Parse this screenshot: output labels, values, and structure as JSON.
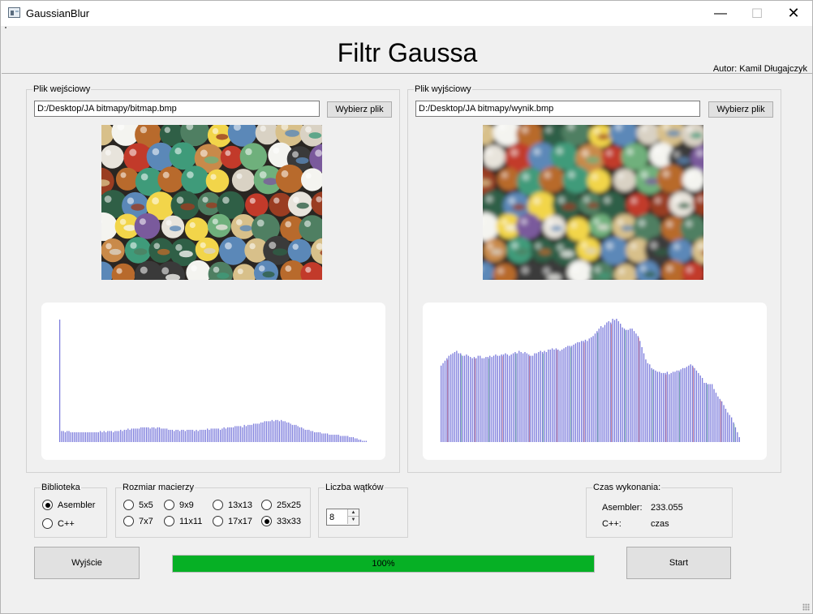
{
  "window": {
    "title": "GaussianBlur",
    "controls": {
      "minimize": "—",
      "maximize": "☐",
      "close": "✕"
    }
  },
  "header": {
    "title": "Filtr Gaussa",
    "author": "Autor: Kamil Długajczyk"
  },
  "input_panel": {
    "label": "Plik wejściowy",
    "path": "D:/Desktop/JA bitmapy/bitmap.bmp",
    "button": "Wybierz plik"
  },
  "output_panel": {
    "label": "Plik wyjściowy",
    "path": "D:/Desktop/JA bitmapy/wynik.bmp",
    "button": "Wybierz plik"
  },
  "library": {
    "label": "Biblioteka",
    "options": [
      {
        "label": "Asembler",
        "checked": true
      },
      {
        "label": "C++",
        "checked": false
      }
    ]
  },
  "matrix": {
    "label": "Rozmiar macierzy",
    "options": [
      {
        "label": "5x5",
        "checked": false
      },
      {
        "label": "9x9",
        "checked": false
      },
      {
        "label": "13x13",
        "checked": false
      },
      {
        "label": "25x25",
        "checked": false
      },
      {
        "label": "7x7",
        "checked": false
      },
      {
        "label": "11x11",
        "checked": false
      },
      {
        "label": "17x17",
        "checked": false
      },
      {
        "label": "33x33",
        "checked": true
      }
    ]
  },
  "threads": {
    "label": "Liczba wątków",
    "value": "8"
  },
  "timing": {
    "label": "Czas wykonania:",
    "asm_label": "Asembler:",
    "asm_value": "233.055",
    "cpp_label": "C++:",
    "cpp_value": "czas"
  },
  "buttons": {
    "exit": "Wyjście",
    "start": "Start"
  },
  "progress": {
    "value": 100,
    "text": "100%"
  },
  "colors": {
    "progress": "#06b025",
    "histogram_bar": "#7b7bdc",
    "histogram_red": "#d96b6b",
    "histogram_green": "#6bc48a"
  },
  "chart_data": [
    {
      "type": "bar",
      "values": [
        100,
        9,
        9,
        8,
        9,
        9,
        8,
        8,
        8,
        8,
        8,
        8,
        8,
        8,
        8,
        8,
        8,
        8,
        8,
        8,
        8,
        8,
        9,
        8,
        9,
        8,
        9,
        9,
        9,
        8,
        9,
        9,
        9,
        10,
        9,
        10,
        10,
        11,
        10,
        11,
        11,
        11,
        11,
        11,
        12,
        12,
        12,
        12,
        12,
        11,
        12,
        12,
        11,
        12,
        12,
        11,
        11,
        11,
        11,
        10,
        10,
        10,
        9,
        10,
        10,
        9,
        10,
        10,
        9,
        10,
        10,
        10,
        10,
        9,
        10,
        9,
        10,
        10,
        10,
        10,
        11,
        10,
        11,
        11,
        11,
        11,
        11,
        10,
        11,
        12,
        11,
        12,
        12,
        12,
        12,
        13,
        13,
        13,
        13,
        12,
        14,
        13,
        14,
        14,
        14,
        15,
        15,
        15,
        15,
        16,
        16,
        17,
        17,
        17,
        17,
        18,
        17,
        18,
        18,
        17,
        18,
        17,
        17,
        16,
        16,
        15,
        14,
        14,
        14,
        13,
        12,
        12,
        11,
        10,
        10,
        10,
        9,
        9,
        8,
        8,
        8,
        8,
        7,
        7,
        7,
        7,
        6,
        6,
        6,
        6,
        6,
        6,
        5,
        5,
        5,
        5,
        5,
        4,
        4,
        4,
        3,
        3,
        2,
        2,
        1,
        1,
        1
      ]
    },
    {
      "type": "bar",
      "values": [
        62,
        64,
        66,
        68,
        70,
        71,
        72,
        73,
        74,
        72,
        72,
        70,
        70,
        71,
        70,
        69,
        68,
        69,
        68,
        70,
        70,
        68,
        68,
        69,
        69,
        70,
        69,
        70,
        71,
        70,
        70,
        71,
        71,
        72,
        71,
        70,
        71,
        72,
        73,
        72,
        74,
        73,
        72,
        73,
        72,
        71,
        70,
        70,
        72,
        72,
        73,
        74,
        73,
        74,
        73,
        75,
        75,
        76,
        75,
        76,
        75,
        74,
        75,
        76,
        77,
        78,
        78,
        78,
        79,
        80,
        81,
        81,
        82,
        82,
        83,
        82,
        84,
        85,
        86,
        88,
        90,
        92,
        94,
        93,
        95,
        97,
        98,
        97,
        100,
        99,
        100,
        98,
        96,
        93,
        92,
        91,
        91,
        92,
        92,
        90,
        88,
        86,
        82,
        77,
        72,
        67,
        64,
        63,
        60,
        59,
        58,
        57,
        57,
        56,
        56,
        56,
        57,
        55,
        56,
        57,
        57,
        58,
        58,
        59,
        60,
        60,
        61,
        62,
        63,
        62,
        60,
        58,
        56,
        54,
        52,
        48,
        48,
        47,
        47,
        47,
        43,
        40,
        37,
        35,
        33,
        30,
        27,
        24,
        22,
        20,
        16,
        12,
        8,
        4
      ]
    }
  ]
}
